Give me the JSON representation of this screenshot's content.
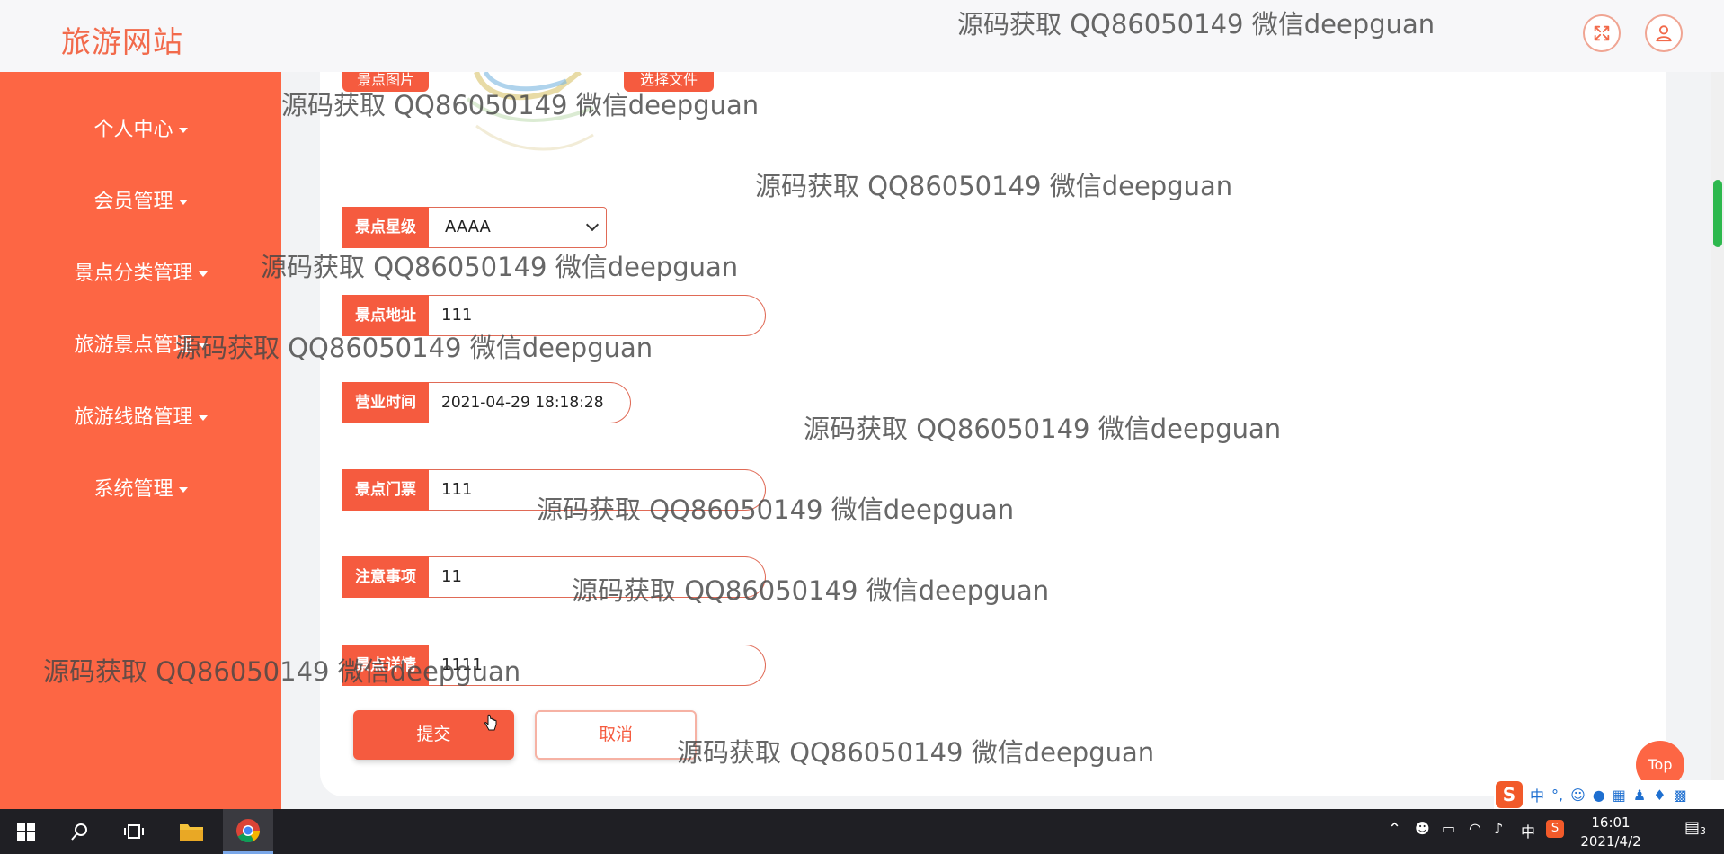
{
  "header": {
    "brand": "旅游网站",
    "fullscreen_icon": "expand-arrows-icon",
    "user_icon": "user-icon"
  },
  "sidebar": {
    "items": [
      {
        "label": "个人中心"
      },
      {
        "label": "会员管理"
      },
      {
        "label": "景点分类管理"
      },
      {
        "label": "旅游景点管理"
      },
      {
        "label": "旅游线路管理"
      },
      {
        "label": "系统管理"
      }
    ]
  },
  "form": {
    "image_label": "景点图片",
    "choose_file_label": "选择文件",
    "star": {
      "label": "景点星级",
      "value": "AAAA"
    },
    "address": {
      "label": "景点地址",
      "value": "111"
    },
    "hours": {
      "label": "营业时间",
      "value": "2021-04-29 18:18:28"
    },
    "ticket": {
      "label": "景点门票",
      "value": "111"
    },
    "notes": {
      "label": "注意事项",
      "value": "11"
    },
    "last": {
      "label": "景点详情",
      "value": "1111"
    },
    "submit_label": "提交",
    "cancel_label": "取消"
  },
  "top_button_label": "Top",
  "watermark_text": "源码获取 QQ86050149 微信deepguan",
  "ime": {
    "lang": "中",
    "punct": "°,"
  },
  "taskbar": {
    "time": "16:01",
    "date": "2021/4/2",
    "ime_lang": "中",
    "notification_count": "3"
  }
}
